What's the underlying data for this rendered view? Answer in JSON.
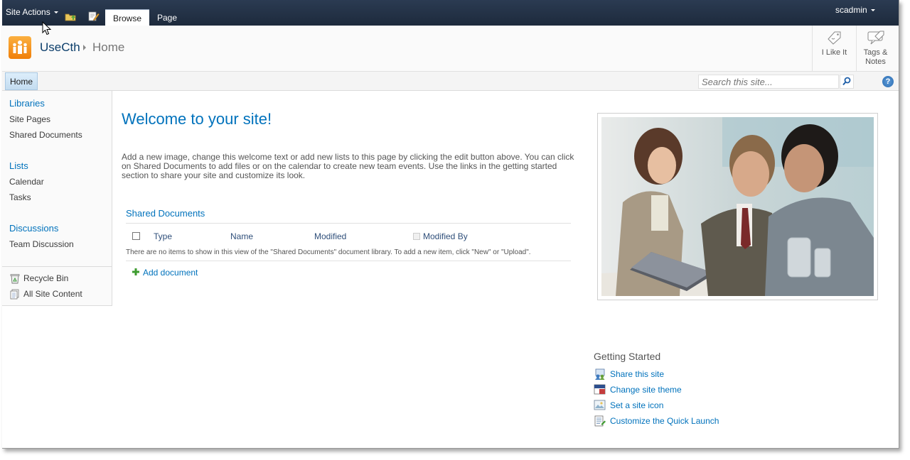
{
  "ribbon": {
    "site_actions": "Site Actions",
    "tabs": [
      {
        "label": "Browse",
        "active": true
      },
      {
        "label": "Page",
        "active": false
      }
    ],
    "user": "scadmin",
    "icons": [
      "navigate-up-icon",
      "edit-page-icon"
    ]
  },
  "title_area": {
    "site_title": "UseCth",
    "breadcrumb_current": "Home",
    "social": {
      "like": "I Like It",
      "tags_line1": "Tags &",
      "tags_line2": "Notes"
    }
  },
  "top_nav": {
    "home": "Home",
    "search_placeholder": "Search this site...",
    "help": "?"
  },
  "quick_launch": {
    "libraries": {
      "heading": "Libraries",
      "items": [
        "Site Pages",
        "Shared Documents"
      ]
    },
    "lists": {
      "heading": "Lists",
      "items": [
        "Calendar",
        "Tasks"
      ]
    },
    "discussions": {
      "heading": "Discussions",
      "items": [
        "Team Discussion"
      ]
    },
    "utilities": [
      "Recycle Bin",
      "All Site Content"
    ]
  },
  "main": {
    "welcome_title": "Welcome to your site!",
    "welcome_text": "Add a new image, change this welcome text or add new lists to this page by clicking the edit button above. You can click on Shared Documents to add files or on the calendar to create new team events. Use the links in the getting started section to share your site and customize its look.",
    "doc_library": {
      "title": "Shared Documents",
      "columns": [
        "Type",
        "Name",
        "Modified",
        "Modified By"
      ],
      "empty_message": "There are no items to show in this view of the \"Shared Documents\" document library. To add a new item, click \"New\" or \"Upload\".",
      "add_link": "Add document"
    }
  },
  "getting_started": {
    "title": "Getting Started",
    "links": [
      "Share this site",
      "Change site theme",
      "Set a site icon",
      "Customize the Quick Launch"
    ]
  },
  "colors": {
    "ribbon": "#1d2a3c",
    "link": "#0072bc",
    "accent": "#f07f09"
  }
}
